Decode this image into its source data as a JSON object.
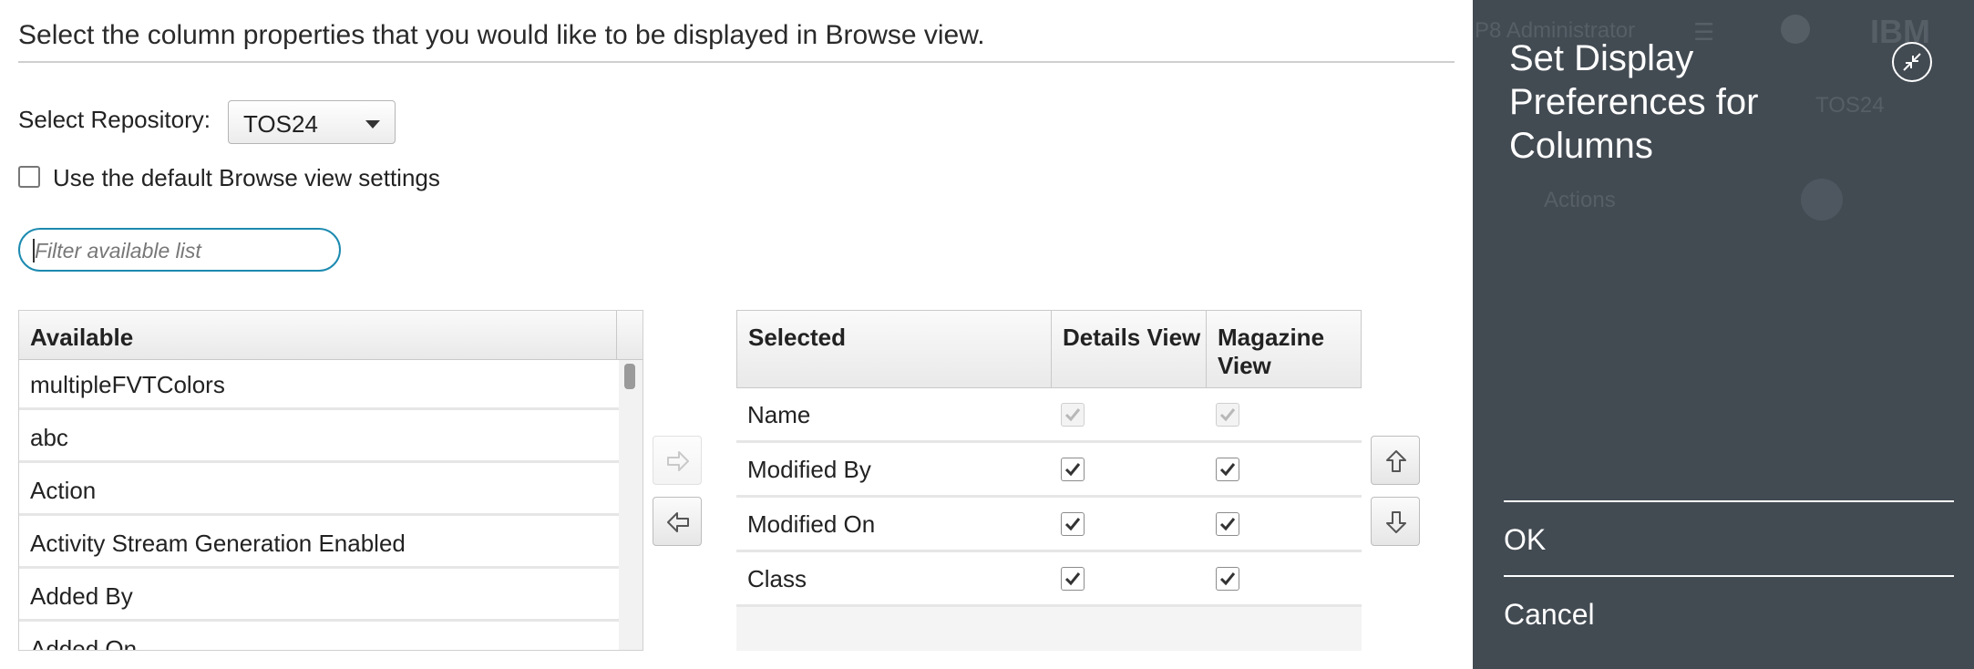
{
  "instruction": "Select the column properties that you would like to be displayed in Browse view.",
  "repository": {
    "label": "Select Repository:",
    "value": "TOS24"
  },
  "default_setting": {
    "label": "Use the default Browse view settings",
    "checked": false
  },
  "filter": {
    "placeholder": "Filter available list",
    "value": ""
  },
  "available": {
    "header": "Available",
    "items": [
      "multipleFVTColors",
      "abc",
      "Action",
      "Activity Stream Generation Enabled",
      "Added By",
      "Added On"
    ]
  },
  "move_buttons": {
    "add_icon": "arrow-right-icon",
    "remove_icon": "arrow-left-icon",
    "up_icon": "arrow-up-icon",
    "down_icon": "arrow-down-icon"
  },
  "selected": {
    "headers": {
      "name": "Selected",
      "details": "Details View",
      "magazine": "Magazine View"
    },
    "rows": [
      {
        "name": "Name",
        "details": true,
        "magazine": true,
        "disabled": true
      },
      {
        "name": "Modified By",
        "details": true,
        "magazine": true,
        "disabled": false
      },
      {
        "name": "Modified On",
        "details": true,
        "magazine": true,
        "disabled": false
      },
      {
        "name": "Class",
        "details": true,
        "magazine": true,
        "disabled": false
      }
    ]
  },
  "panel": {
    "title": "Set Display Preferences for Columns",
    "ok": "OK",
    "cancel": "Cancel",
    "collapse_icon": "collapse-icon",
    "background": "#424a52"
  },
  "background_app": {
    "user": "P8 Administrator",
    "repo": "TOS24",
    "actions": "Actions",
    "brand": "IBM"
  }
}
